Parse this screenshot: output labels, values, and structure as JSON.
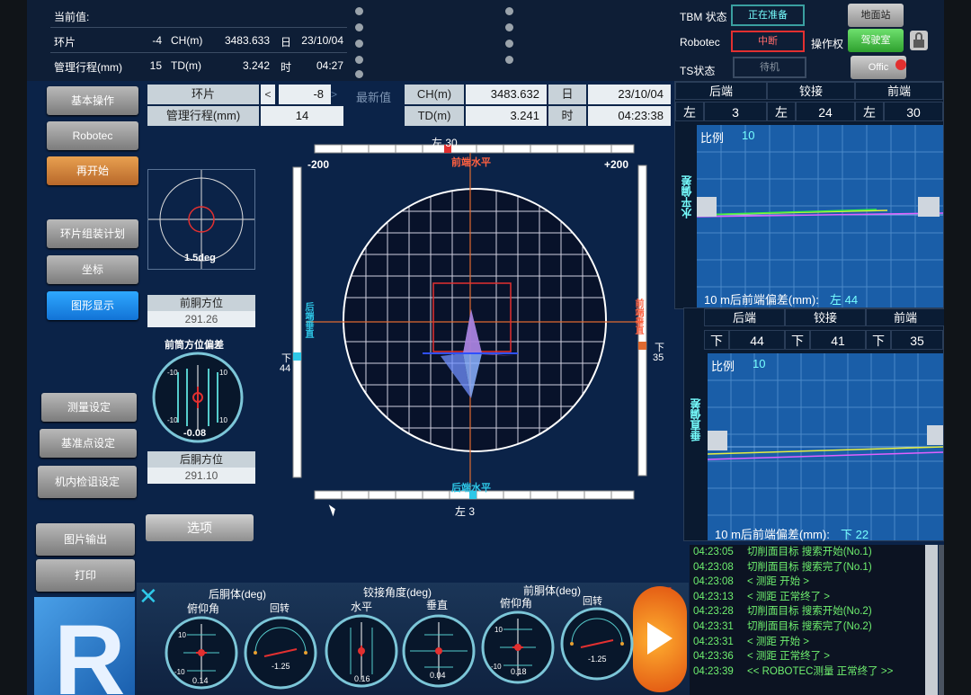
{
  "top": {
    "current_title": "当前值:",
    "ring_label": "环片",
    "ring_value": "-4",
    "ch_label": "CH(m)",
    "ch_value": "3483.633",
    "day_label": "日",
    "day_value": "23/10/04",
    "mgmt_label": "管理行程(mm)",
    "mgmt_value": "15",
    "td_label": "TD(m)",
    "td_value": "3.242",
    "time_label": "时",
    "time_value": "04:27",
    "tbm_label": "TBM 状态",
    "tbm_status": "正在准备",
    "robotec_label": "Robotec",
    "robotec_status": "中断",
    "ts_label": "TS状态",
    "ts_status": "待机",
    "ground_btn": "地面站",
    "control_label": "操作权",
    "control_btn": "驾驶室",
    "office_btn": "Offic"
  },
  "nav": {
    "basic": "基本操作",
    "robotec": "Robotec",
    "restart": "再开始",
    "ring_plan": "环片组装计划",
    "coords": "坐标",
    "graphic": "图形显示",
    "measure_settings": "测量设定",
    "ref_settings": "基准点设定",
    "internal_calib": "机内检诅设定",
    "image_out": "图片输出",
    "print": "打印"
  },
  "latest": {
    "ring_label": "环片",
    "ring_value": "-8",
    "latest_label": "最新值",
    "ch_label": "CH(m)",
    "ch_value": "3483.632",
    "day_label": "日",
    "day_value": "23/10/04",
    "mgmt_label": "管理行程(mm)",
    "mgmt_value": "14",
    "td_label": "TD(m)",
    "td_value": "3.241",
    "time_label": "时",
    "time_value": "04:23:38"
  },
  "left_panel": {
    "deg_label": "1.5deg",
    "front_bearing_label": "前胴方位",
    "front_bearing_value": "291.26",
    "front_dev_label": "前筒方位偏差",
    "front_dev_value": "-0.08",
    "rear_bearing_label": "后胴方位",
    "rear_bearing_value": "291.10",
    "options_btn": "选项"
  },
  "target": {
    "top_label": "左 30",
    "bottom_label": "左 3",
    "front_label": "前端水平",
    "rear_label": "后端水平",
    "left_range": "-200",
    "right_range": "+200",
    "left_down": "下",
    "left_down_value": "44",
    "right_down": "下",
    "right_down_value": "35",
    "left_vertical": "后端垂直",
    "right_vertical": "前端垂直"
  },
  "horiz_panel": {
    "h_rear": "后端",
    "h_joint": "铰接",
    "h_front": "前端",
    "dir1": "左",
    "v1": "3",
    "dir2": "左",
    "v2": "24",
    "dir3": "左",
    "v3": "30",
    "scale_label": "比例",
    "scale_value": "10",
    "axis_label": "水平偏差",
    "footer": "10 m后前端偏差(mm):",
    "footer_value": "左 44"
  },
  "vert_panel": {
    "h_rear": "后端",
    "h_joint": "铰接",
    "h_front": "前端",
    "dir1": "下",
    "v1": "44",
    "dir2": "下",
    "v2": "41",
    "dir3": "下",
    "v3": "35",
    "scale_label": "比例",
    "scale_value": "10",
    "axis_label": "垂直偏差",
    "footer": "10 m后前端偏差(mm):",
    "footer_value": "下 22"
  },
  "log": [
    {
      "time": "04:23:05",
      "msg": "切削面目标 搜索开始(No.1)"
    },
    {
      "time": "04:23:08",
      "msg": "切削面目标 搜索完了(No.1)"
    },
    {
      "time": "04:23:08",
      "msg": "< 测距 开始 >"
    },
    {
      "time": "04:23:13",
      "msg": "< 测距 正常终了 >"
    },
    {
      "time": "04:23:28",
      "msg": "切削面目标 搜索开始(No.2)"
    },
    {
      "time": "04:23:31",
      "msg": "切削面目标 搜索完了(No.2)"
    },
    {
      "time": "04:23:31",
      "msg": "< 测距 开始 >"
    },
    {
      "time": "04:23:36",
      "msg": "< 测距 正常终了 >"
    },
    {
      "time": "04:23:39",
      "msg": "<< ROBOTEC测量 正常终了 >>"
    }
  ],
  "bottom": {
    "rear_body": "后胴体(deg)",
    "articulation": "铰接角度(deg)",
    "front_body": "前胴体(deg)",
    "pitch1": "俯仰角",
    "roll1": "回转",
    "horizontal": "水平",
    "vertical": "垂直",
    "pitch2": "俯仰角",
    "roll2": "回转",
    "g1_value": "0.14",
    "g2_value": "-1.25",
    "g3_value": "0.16",
    "g4_value": "0.04",
    "g5_value": "0.18",
    "g6_value": "-1.25"
  },
  "colors": {
    "accent": "#1a8cff",
    "alert": "#e23030",
    "ok": "#40d040",
    "log_text": "#6ff06f"
  }
}
